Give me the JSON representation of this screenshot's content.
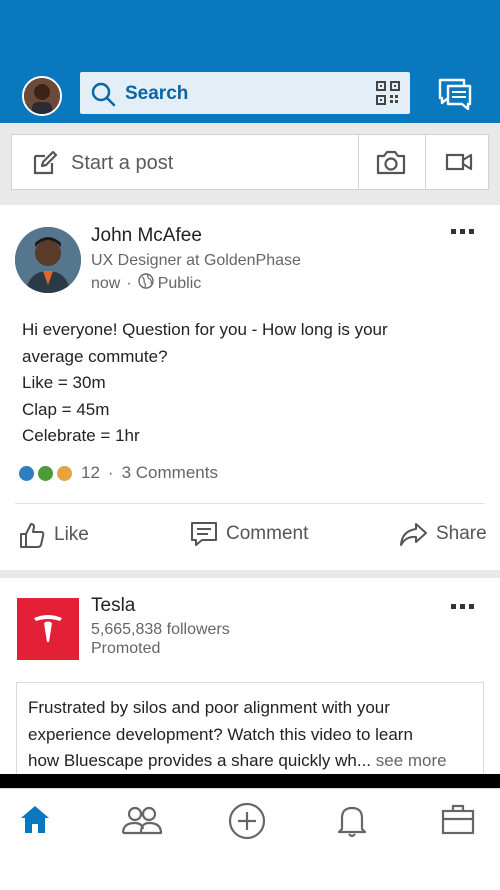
{
  "header": {
    "search_label": "Search"
  },
  "compose": {
    "label": "Start a post"
  },
  "post": {
    "author": "John McAfee",
    "title": "UX Designer at GoldenPhase",
    "time": "now",
    "visibility": "Public",
    "body_lines": [
      "Hi everyone! Question for you - How long is your",
      "average commute?",
      "Like = 30m",
      "Clap = 45m",
      "Celebrate = 1hr"
    ],
    "reaction_count": "12",
    "comments": "3 Comments",
    "actions": {
      "like": "Like",
      "comment": "Comment",
      "share": "Share"
    }
  },
  "ad": {
    "company": "Tesla",
    "followers": "5,665,838 followers",
    "promoted": "Promoted",
    "text_lines": [
      "Frustrated by silos and poor alignment with your",
      "experience development? Watch this video to learn",
      "how Bluescape provides a share quickly wh..."
    ],
    "see_more": "see more"
  },
  "colors": {
    "brand_blue": "#0a78bf",
    "tesla_red": "#e32036"
  }
}
